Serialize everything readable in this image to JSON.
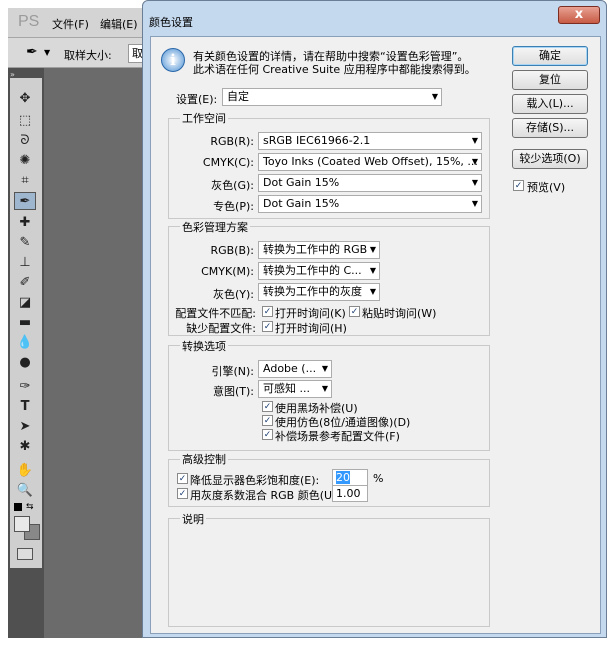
{
  "photoshop": {
    "logo": "PS",
    "menus": [
      "文件(F)",
      "编辑(E)"
    ],
    "options_label": "取样大小:",
    "options_partial": "取"
  },
  "dialog": {
    "title": "颜色设置",
    "close_glyph": "x",
    "info_line1": "有关颜色设置的详情，请在帮助中搜索“设置色彩管理”。",
    "info_line2": "此术语在任何 Creative Suite 应用程序中都能搜索得到。",
    "settings_label": "设置(E):",
    "settings_value": "自定",
    "working_spaces": {
      "title": "工作空间",
      "rgb_label": "RGB(R):",
      "rgb_value": "sRGB IEC61966-2.1",
      "cmyk_label": "CMYK(C):",
      "cmyk_value": "Toyo Inks (Coated Web Offset), 15%, ...",
      "gray_label": "灰色(G):",
      "gray_value": "Dot Gain 15%",
      "spot_label": "专色(P):",
      "spot_value": "Dot Gain 15%"
    },
    "color_management": {
      "title": "色彩管理方案",
      "rgb_label": "RGB(B):",
      "rgb_value": "转换为工作中的 RGB",
      "cmyk_label": "CMYK(M):",
      "cmyk_value": "转换为工作中的 C...",
      "gray_label": "灰色(Y):",
      "gray_value": "转换为工作中的灰度",
      "mismatch_label": "配置文件不匹配:",
      "mismatch_open": "打开时询问(K)",
      "mismatch_open_checked": true,
      "mismatch_paste": "粘贴时询问(W)",
      "mismatch_paste_checked": true,
      "missing_label": "缺少配置文件:",
      "missing_open": "打开时询问(H)",
      "missing_open_checked": true
    },
    "conversion": {
      "title": "转换选项",
      "engine_label": "引擎(N):",
      "engine_value": "Adobe (...",
      "intent_label": "意图(T):",
      "intent_value": "可感知",
      "intent_more": "...",
      "bpc": "使用黑场补偿(U)",
      "bpc_checked": true,
      "dither": "使用仿色(8位/通道图像)(D)",
      "dither_checked": true,
      "compensate": "补偿场景参考配置文件(F)",
      "compensate_checked": true
    },
    "advanced": {
      "title": "高级控制",
      "desaturate": "降低显示器色彩饱和度(E):",
      "desaturate_checked": true,
      "desaturate_value": "20",
      "percent": "%",
      "blend": "用灰度系数混合 RGB 颜色(U):",
      "blend_checked": true,
      "blend_value": "1.00"
    },
    "description": {
      "title": "说明"
    },
    "buttons": {
      "ok": "确定",
      "reset": "复位",
      "load": "载入(L)...",
      "save": "存储(S)...",
      "fewer_options": "较少选项(O)",
      "preview": "预览(V)",
      "preview_checked": true
    },
    "check_glyph": "✓"
  }
}
